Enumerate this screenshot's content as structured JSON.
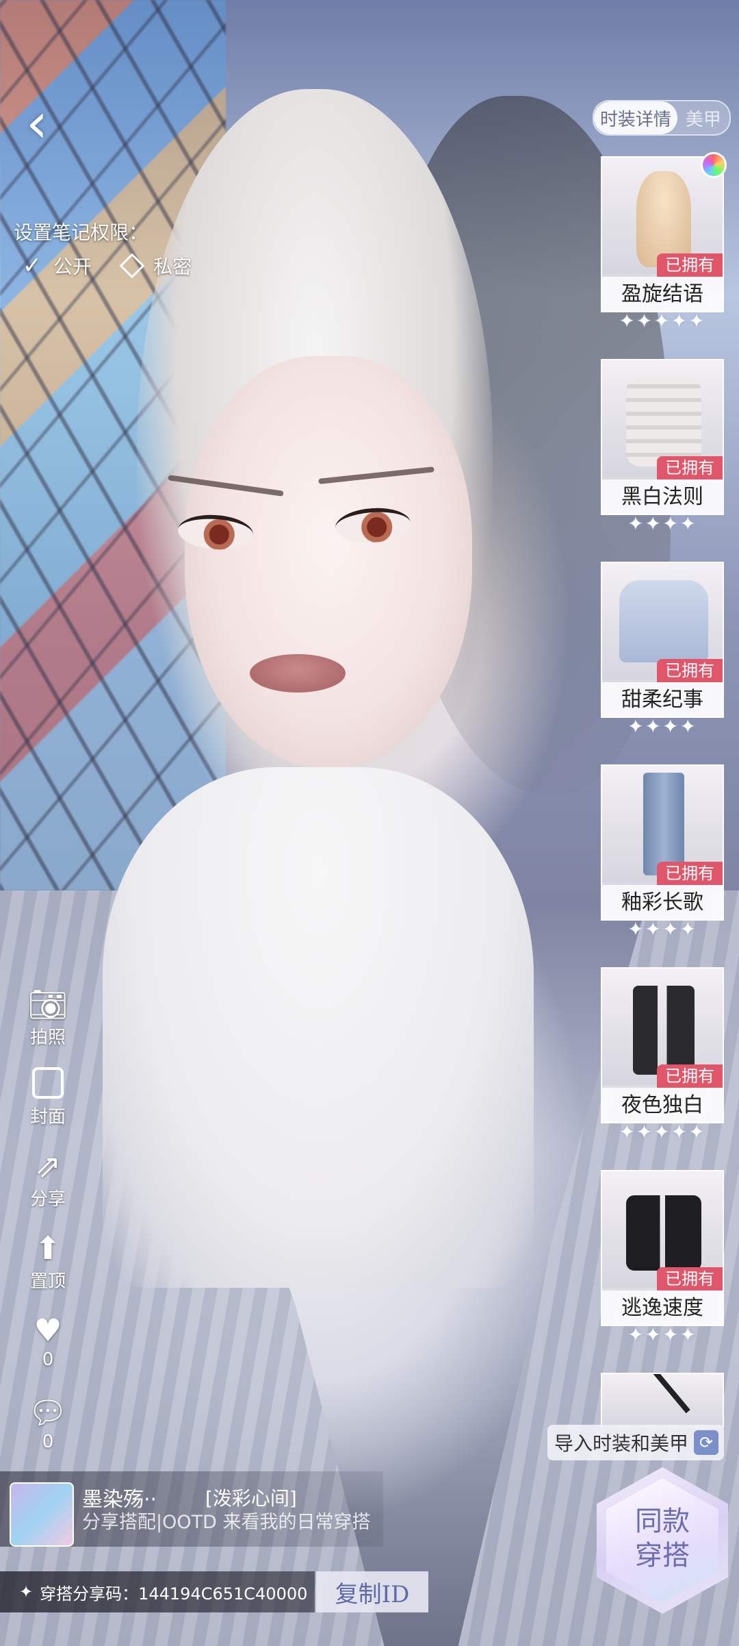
{
  "header": {
    "back_icon": "chevron-left-icon"
  },
  "permission": {
    "label": "设置笔记权限：",
    "options": [
      {
        "label": "公开",
        "icon": "check-icon",
        "selected": true
      },
      {
        "label": "私密",
        "icon": "diamond-icon",
        "selected": false
      }
    ]
  },
  "tabs": [
    {
      "label": "时装详情",
      "active": true
    },
    {
      "label": "美甲",
      "active": false
    }
  ],
  "items": [
    {
      "name": "盈旋结语",
      "owned": "已拥有",
      "stars": "✦✦✦✦✦",
      "icon": "hair-icon"
    },
    {
      "name": "黑白法则",
      "owned": "已拥有",
      "stars": "✦✦✦✦",
      "icon": "jacket-icon"
    },
    {
      "name": "甜柔纪事",
      "owned": "已拥有",
      "stars": "✦✦✦✦",
      "icon": "sweater-icon"
    },
    {
      "name": "釉彩长歌",
      "owned": "已拥有",
      "stars": "✦✦✦✦",
      "icon": "jeans-icon"
    },
    {
      "name": "夜色独白",
      "owned": "已拥有",
      "stars": "✦✦✦✦✦",
      "icon": "boots-icon"
    },
    {
      "name": "逃逸速度",
      "owned": "已拥有",
      "stars": "✦✦✦✦",
      "icon": "shoes-icon"
    }
  ],
  "import_button": {
    "label": "导入时装和美甲",
    "icon": "refresh-icon"
  },
  "side_actions": [
    {
      "label": "拍照",
      "icon": "camera-icon"
    },
    {
      "label": "封面",
      "icon": "cover-icon"
    },
    {
      "label": "分享",
      "icon": "share-icon"
    },
    {
      "label": "置顶",
      "icon": "pin-top-icon"
    },
    {
      "label": "0",
      "icon": "heart-icon"
    },
    {
      "label": "0",
      "icon": "comment-icon"
    }
  ],
  "author": {
    "name": "墨染殇··",
    "tag": "[泼彩心间]",
    "description": "分享搭配|OOTD 来看我的日常穿搭"
  },
  "share_code": {
    "label": "穿搭分享码：144194C651C40000",
    "copy_label": "复制ID"
  },
  "same_outfit": {
    "line1": "同款",
    "line2": "穿搭"
  }
}
